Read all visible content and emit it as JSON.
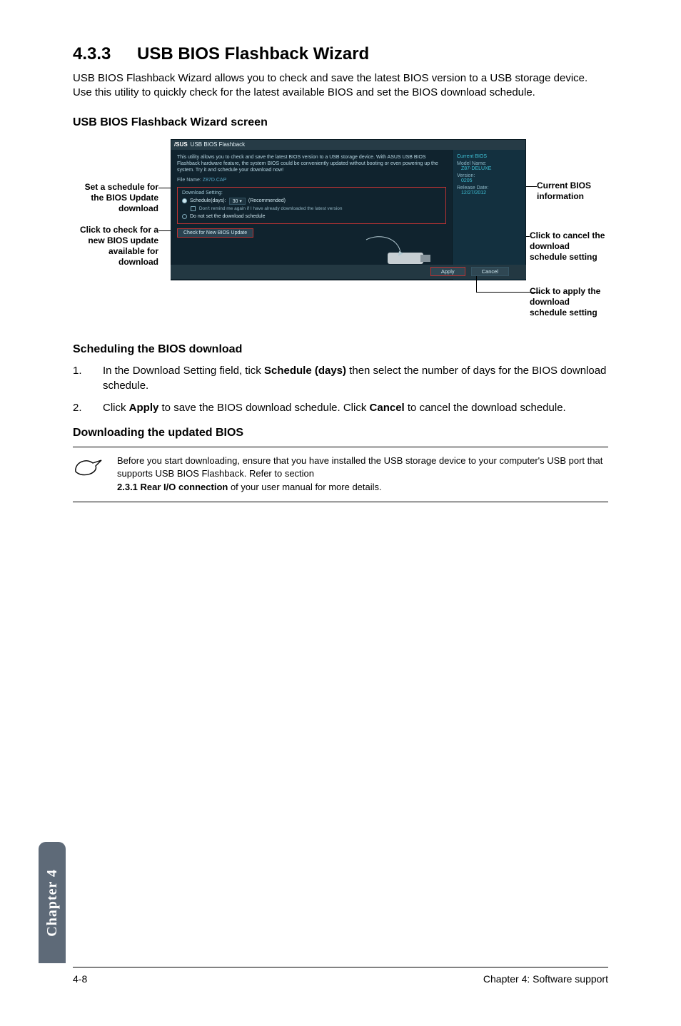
{
  "section": {
    "number": "4.3.3",
    "title": "USB BIOS Flashback Wizard"
  },
  "intro": "USB BIOS Flashback Wizard allows you to check and save the latest BIOS version to a USB storage device. Use this utility to quickly check for the latest available BIOS and set the BIOS download schedule.",
  "sub1": "USB BIOS Flashback Wizard screen",
  "anno": {
    "schedule": "Set a schedule for the BIOS Update download",
    "check": "Click to check for a new BIOS update available for download",
    "current": "Current BIOS information",
    "cancel": "Click to cancel the download schedule setting",
    "apply": "Click to apply the download schedule setting"
  },
  "app": {
    "titlebar_logo": "/SUS",
    "titlebar_text": "USB BIOS Flashback",
    "desc": "This utility allows you to check and save the latest BIOS version to a USB storage device. With ASUS USB BIOS Flashback hardware feature, the system BIOS could be conveniently updated without booting or even powering up the system. Try it and schedule your download now!",
    "filename_label": "File Name:",
    "filename_value": "Z87D.CAP",
    "download_setting": "Download Setting:",
    "schedule_label": "Schedule(days):",
    "schedule_value": "30",
    "recommended": "(Recommended)",
    "remind": "Don't remind me again if I have already downloaded the latest version",
    "noset": "Do not set the download schedule",
    "check_btn": "Check for New BIOS Update",
    "side": {
      "header": "Current BIOS",
      "model_l": "Model Name:",
      "model_v": "Z87-DELUXE",
      "ver_l": "Version:",
      "ver_v": "0205",
      "rel_l": "Release Date:",
      "rel_v": "12/27/2012"
    },
    "apply_btn": "Apply",
    "cancel_btn": "Cancel"
  },
  "sched_h": "Scheduling the BIOS download",
  "steps": [
    {
      "n": "1.",
      "pre": "In the Download Setting field, tick ",
      "b": "Schedule (days)",
      "post": " then select the number of days for the BIOS download schedule."
    },
    {
      "n": "2.",
      "pre": "Click ",
      "b": "Apply",
      "mid": " to save the BIOS download schedule. Click ",
      "b2": "Cancel",
      "post": " to cancel the download schedule."
    }
  ],
  "dl_h": "Downloading the updated BIOS",
  "note": {
    "line1": "Before you start downloading, ensure that you have installed the USB storage device to your computer's USB port that supports USB BIOS Flashback. Refer to section ",
    "bold": "2.3.1 Rear I/O connection",
    "line2": " of your user manual for more details."
  },
  "sidetab": "Chapter 4",
  "footer": {
    "left": "4-8",
    "right": "Chapter 4: Software support"
  }
}
